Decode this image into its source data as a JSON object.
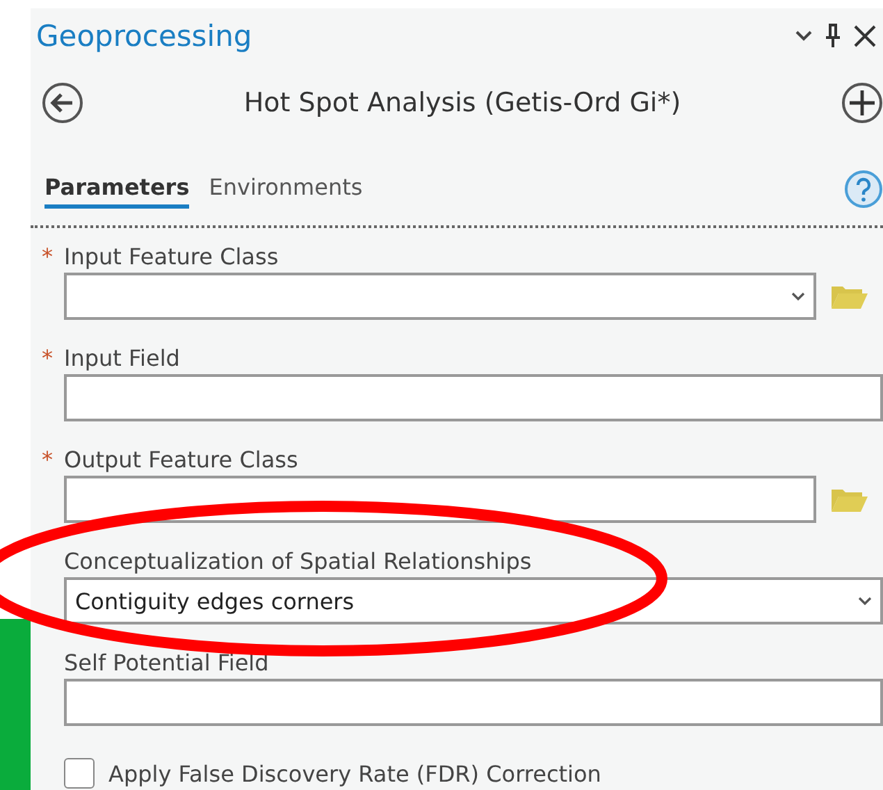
{
  "pane": {
    "title": "Geoprocessing"
  },
  "tool": {
    "title": "Hot Spot Analysis (Getis-Ord Gi*)"
  },
  "tabs": [
    {
      "label": "Parameters",
      "selected": true
    },
    {
      "label": "Environments",
      "selected": false
    }
  ],
  "parameters": [
    {
      "kind": "dropdown",
      "required_mark": "*",
      "label": "Input Feature Class",
      "browse": true
    },
    {
      "kind": "text",
      "required_mark": "*",
      "label": "Input Field",
      "browse": false
    },
    {
      "kind": "text",
      "required_mark": "*",
      "label": "Output Feature Class",
      "browse": true
    },
    {
      "kind": "dropdown",
      "label": "Conceptualization of Spatial Relationships",
      "value": "Contiguity edges corners",
      "browse": false
    },
    {
      "kind": "text",
      "label": "Self Potential Field",
      "browse": false
    },
    {
      "kind": "checkbox",
      "label": "Apply False Discovery Rate (FDR) Correction",
      "checked": false
    }
  ]
}
